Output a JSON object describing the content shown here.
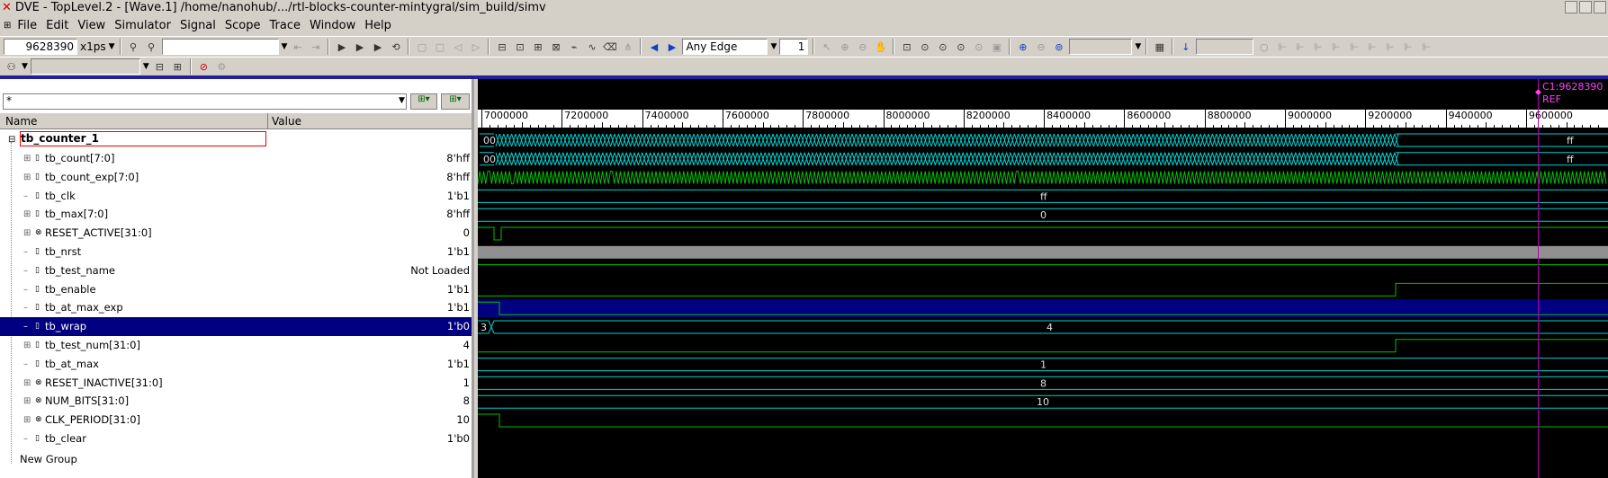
{
  "window": {
    "title": "DVE - TopLevel.2 - [Wave.1]  /home/nanohub/.../rtl-blocks-counter-mintygral/sim_build/simv"
  },
  "menu": [
    "File",
    "Edit",
    "View",
    "Simulator",
    "Signal",
    "Scope",
    "Trace",
    "Window",
    "Help"
  ],
  "toolbar": {
    "time_value": "9628390",
    "time_unit": "x1ps",
    "search_placeholder": "",
    "edge_select": "Any Edge",
    "edge_count": "1"
  },
  "signal_pane": {
    "filter_value": "*",
    "col_name": "Name",
    "col_value": "Value",
    "scope": "tb_counter_1",
    "signals": [
      {
        "name": "tb_count[7:0]",
        "value": "8'hff",
        "expand": "+",
        "icon": "▯"
      },
      {
        "name": "tb_count_exp[7:0]",
        "value": "8'hff",
        "expand": "+",
        "icon": "▯"
      },
      {
        "name": "tb_clk",
        "value": "1'b1",
        "expand": "",
        "icon": "▯"
      },
      {
        "name": "tb_max[7:0]",
        "value": "8'hff",
        "expand": "+",
        "icon": "▯"
      },
      {
        "name": "RESET_ACTIVE[31:0]",
        "value": "0",
        "expand": "+",
        "icon": "⊗"
      },
      {
        "name": "tb_nrst",
        "value": "1'b1",
        "expand": "",
        "icon": "▯"
      },
      {
        "name": "tb_test_name",
        "value": "Not Loaded",
        "expand": "",
        "icon": "▯"
      },
      {
        "name": "tb_enable",
        "value": "1'b1",
        "expand": "",
        "icon": "▯"
      },
      {
        "name": "tb_at_max_exp",
        "value": "1'b1",
        "expand": "",
        "icon": "▯"
      },
      {
        "name": "tb_wrap",
        "value": "1'b0",
        "expand": "",
        "icon": "▯",
        "selected": true
      },
      {
        "name": "tb_test_num[31:0]",
        "value": "4",
        "expand": "+",
        "icon": "▯"
      },
      {
        "name": "tb_at_max",
        "value": "1'b1",
        "expand": "",
        "icon": "▯"
      },
      {
        "name": "RESET_INACTIVE[31:0]",
        "value": "1",
        "expand": "+",
        "icon": "⊗"
      },
      {
        "name": "NUM_BITS[31:0]",
        "value": "8",
        "expand": "+",
        "icon": "⊗"
      },
      {
        "name": "CLK_PERIOD[31:0]",
        "value": "10",
        "expand": "+",
        "icon": "⊗"
      },
      {
        "name": "tb_clear",
        "value": "1'b0",
        "expand": "",
        "icon": "▯"
      }
    ],
    "new_group": "New Group"
  },
  "wave_pane": {
    "cursor_label": "C1:9628390",
    "ref_label": "REF",
    "ruler_ticks": [
      "7000000",
      "7200000",
      "7400000",
      "7600000",
      "7800000",
      "8000000",
      "8200000",
      "8400000",
      "8600000",
      "8800000",
      "9000000",
      "9200000",
      "9400000",
      "9600000"
    ],
    "bus_labels": {
      "count_start": "00",
      "count_end": "ff",
      "count_exp_start": "00",
      "count_exp_end": "ff",
      "max": "ff",
      "reset_active": "0",
      "test_num_start": "3",
      "test_num": "4",
      "reset_inactive": "1",
      "num_bits": "8",
      "clk_period": "10"
    },
    "colors": {
      "bus": "#00d0d0",
      "clk": "#00c000",
      "level": "#00c000",
      "cursor": "#b000b0"
    }
  }
}
